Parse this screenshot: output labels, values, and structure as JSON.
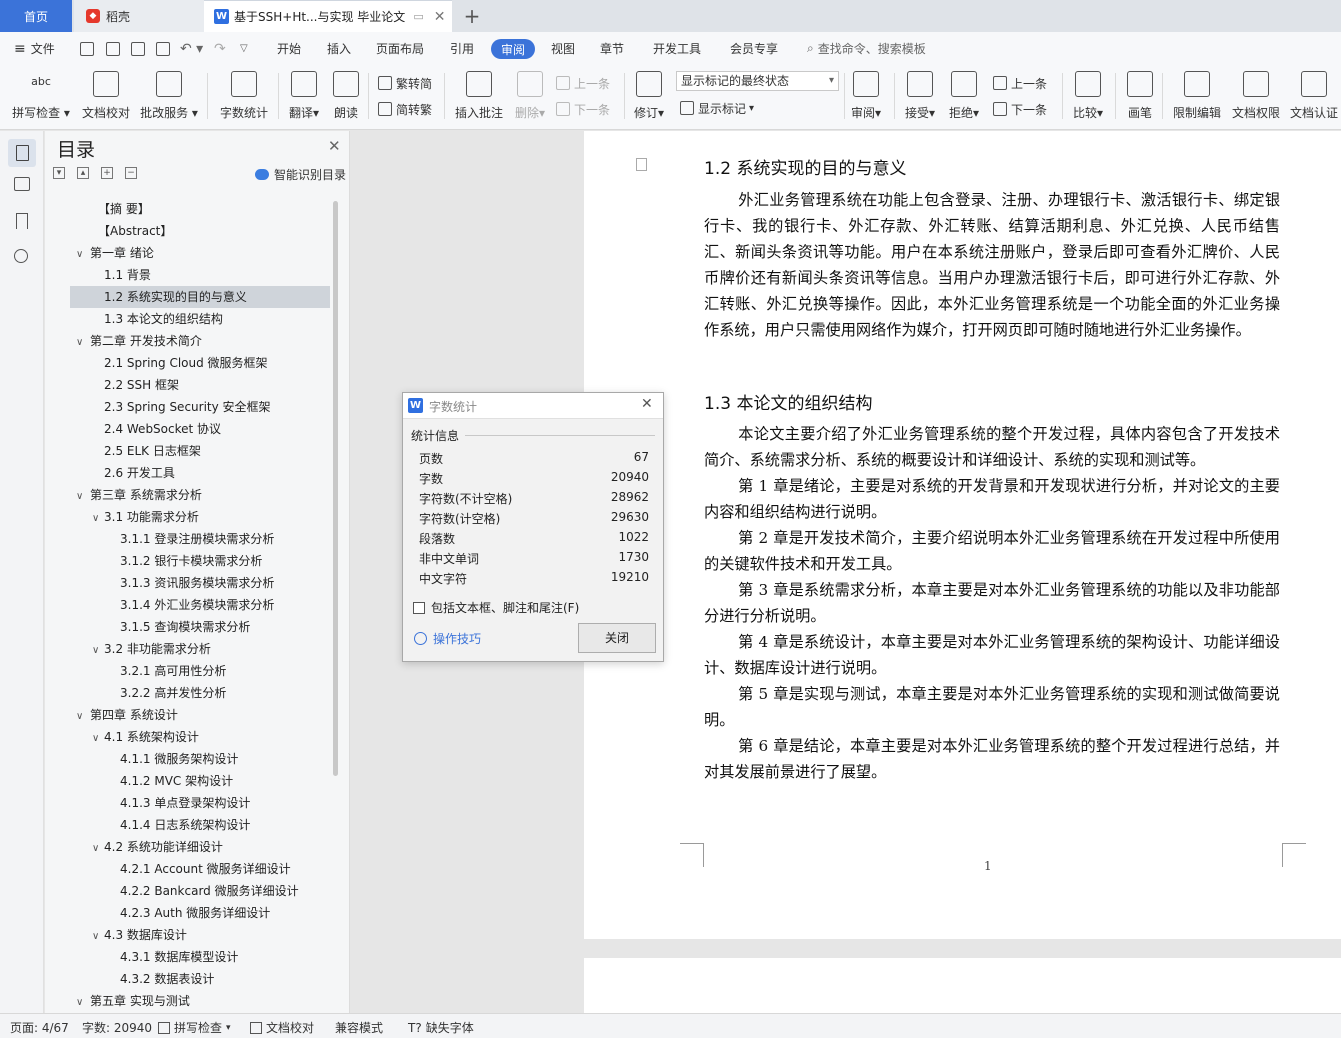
{
  "tabs": {
    "home": "首页",
    "daoke": "稻壳",
    "doc": "基于SSH+Ht...与实现 毕业论文"
  },
  "menu": {
    "file": "文件",
    "items": [
      "开始",
      "插入",
      "页面布局",
      "引用",
      "审阅",
      "视图",
      "章节",
      "开发工具",
      "会员专享"
    ],
    "active": "审阅",
    "search": "查找命令、搜索模板"
  },
  "ribbon": {
    "spell_check": "拼写检查",
    "doc_proof": "文档校对",
    "batch_service": "批改服务",
    "word_count": "字数统计",
    "translate": "翻译",
    "read_aloud": "朗读",
    "trad_to_simp": "繁转简",
    "simp_to_trad": "简转繁",
    "insert_comment": "插入批注",
    "delete": "删除",
    "prev_comment": "上一条",
    "next_comment": "下一条",
    "revise": "修订",
    "markup_mode": "显示标记的最终状态",
    "show_markup": "显示标记",
    "review": "审阅",
    "accept": "接受",
    "reject": "拒绝",
    "prev_change": "上一条",
    "next_change": "下一条",
    "compare": "比较",
    "pen": "画笔",
    "restrict_edit": "限制编辑",
    "doc_permission": "文档权限",
    "doc_cert": "文档认证"
  },
  "toc": {
    "title": "目录",
    "smart": "智能识别目录",
    "items": [
      {
        "text": "【摘  要】",
        "level": 0,
        "arrow": ""
      },
      {
        "text": "【Abstract】",
        "level": 0,
        "arrow": ""
      },
      {
        "text": "第一章  绪论",
        "level": 1,
        "arrow": "v"
      },
      {
        "text": "1.1   背景",
        "level": 2,
        "arrow": ""
      },
      {
        "text": "1.2   系统实现的目的与意义",
        "level": 2,
        "arrow": ""
      },
      {
        "text": "1.3   本论文的组织结构",
        "level": 2,
        "arrow": ""
      },
      {
        "text": "第二章  开发技术简介",
        "level": 1,
        "arrow": "v"
      },
      {
        "text": "2.1   Spring Cloud 微服务框架",
        "level": 2,
        "arrow": ""
      },
      {
        "text": "2.2   SSH 框架",
        "level": 2,
        "arrow": ""
      },
      {
        "text": "2.3   Spring Security 安全框架",
        "level": 2,
        "arrow": ""
      },
      {
        "text": "2.4   WebSocket 协议",
        "level": 2,
        "arrow": ""
      },
      {
        "text": "2.5   ELK 日志框架",
        "level": 2,
        "arrow": ""
      },
      {
        "text": "2.6   开发工具",
        "level": 2,
        "arrow": ""
      },
      {
        "text": "第三章  系统需求分析",
        "level": 1,
        "arrow": "v"
      },
      {
        "text": "3.1   功能需求分析",
        "level": 2,
        "arrow": "v"
      },
      {
        "text": "3.1.1  登录注册模块需求分析",
        "level": 3,
        "arrow": ""
      },
      {
        "text": "3.1.2  银行卡模块需求分析",
        "level": 3,
        "arrow": ""
      },
      {
        "text": "3.1.3  资讯服务模块需求分析",
        "level": 3,
        "arrow": ""
      },
      {
        "text": "3.1.4  外汇业务模块需求分析",
        "level": 3,
        "arrow": ""
      },
      {
        "text": "3.1.5  查询模块需求分析",
        "level": 3,
        "arrow": ""
      },
      {
        "text": "3.2   非功能需求分析",
        "level": 2,
        "arrow": "v"
      },
      {
        "text": "3.2.1  高可用性分析",
        "level": 3,
        "arrow": ""
      },
      {
        "text": "3.2.2  高并发性分析",
        "level": 3,
        "arrow": ""
      },
      {
        "text": "第四章  系统设计",
        "level": 1,
        "arrow": "v"
      },
      {
        "text": "4.1   系统架构设计",
        "level": 2,
        "arrow": "v"
      },
      {
        "text": "4.1.1  微服务架构设计",
        "level": 3,
        "arrow": ""
      },
      {
        "text": "4.1.2 MVC 架构设计",
        "level": 3,
        "arrow": ""
      },
      {
        "text": "4.1.3  单点登录架构设计",
        "level": 3,
        "arrow": ""
      },
      {
        "text": "4.1.4  日志系统架构设计",
        "level": 3,
        "arrow": ""
      },
      {
        "text": "4.2   系统功能详细设计",
        "level": 2,
        "arrow": "v"
      },
      {
        "text": "4.2.1 Account 微服务详细设计",
        "level": 3,
        "arrow": ""
      },
      {
        "text": "4.2.2 Bankcard 微服务详细设计",
        "level": 3,
        "arrow": ""
      },
      {
        "text": "4.2.3 Auth 微服务详细设计",
        "level": 3,
        "arrow": ""
      },
      {
        "text": "4.3   数据库设计",
        "level": 2,
        "arrow": "v"
      },
      {
        "text": "4.3.1  数据库模型设计",
        "level": 3,
        "arrow": ""
      },
      {
        "text": "4.3.2  数据表设计",
        "level": 3,
        "arrow": ""
      },
      {
        "text": "第五章  实现与测试",
        "level": 1,
        "arrow": "v"
      }
    ],
    "selected_index": 4
  },
  "document": {
    "h12": "1.2   系统实现的目的与意义",
    "p12": "外汇业务管理系统在功能上包含登录、注册、办理银行卡、激活银行卡、绑定银行卡、我的银行卡、外汇存款、外汇转账、结算活期利息、外汇兑换、人民币结售汇、新闻头条资讯等功能。用户在本系统注册账户，登录后即可查看外汇牌价、人民币牌价还有新闻头条资讯等信息。当用户办理激活银行卡后，即可进行外汇存款、外汇转账、外汇兑换等操作。因此，本外汇业务管理系统是一个功能全面的外汇业务操作系统，用户只需使用网络作为媒介，打开网页即可随时随地进行外汇业务操作。",
    "h13": "1.3   本论文的组织结构",
    "paras13": [
      "本论文主要介绍了外汇业务管理系统的整个开发过程，具体内容包含了开发技术简介、系统需求分析、系统的概要设计和详细设计、系统的实现和测试等。",
      "第 1 章是绪论，主要是对系统的开发背景和开发现状进行分析，并对论文的主要内容和组织结构进行说明。",
      "第 2 章是开发技术简介，主要介绍说明本外汇业务管理系统在开发过程中所使用的关键软件技术和开发工具。",
      "第 3 章是系统需求分析，本章主要是对本外汇业务管理系统的功能以及非功能部分进行分析说明。",
      "第 4 章是系统设计，本章主要是对本外汇业务管理系统的架构设计、功能详细设计、数据库设计进行说明。",
      "第 5 章是实现与测试，本章主要是对本外汇业务管理系统的实现和测试做简要说明。",
      "第 6 章是结论，本章主要是对本外汇业务管理系统的整个开发过程进行总结，并对其发展前景进行了展望。"
    ],
    "page_number": "1"
  },
  "word_count_dialog": {
    "title": "字数统计",
    "section": "统计信息",
    "rows": [
      {
        "label": "页数",
        "value": "67"
      },
      {
        "label": "字数",
        "value": "20940"
      },
      {
        "label": "字符数(不计空格)",
        "value": "28962"
      },
      {
        "label": "字符数(计空格)",
        "value": "29630"
      },
      {
        "label": "段落数",
        "value": "1022"
      },
      {
        "label": "非中文单词",
        "value": "1730"
      },
      {
        "label": "中文字符",
        "value": "19210"
      }
    ],
    "include_label": "包括文本框、脚注和尾注(F)",
    "include_checked": false,
    "tips": "操作技巧",
    "close": "关闭"
  },
  "status": {
    "page": "页面: 4/67",
    "words": "字数: 20940",
    "spell": "拼写检查",
    "proof": "文档校对",
    "compat": "兼容模式",
    "missing_font": "缺失字体"
  },
  "colors": {
    "accent": "#3b73d9",
    "selected_toc": "#cfd4da"
  }
}
